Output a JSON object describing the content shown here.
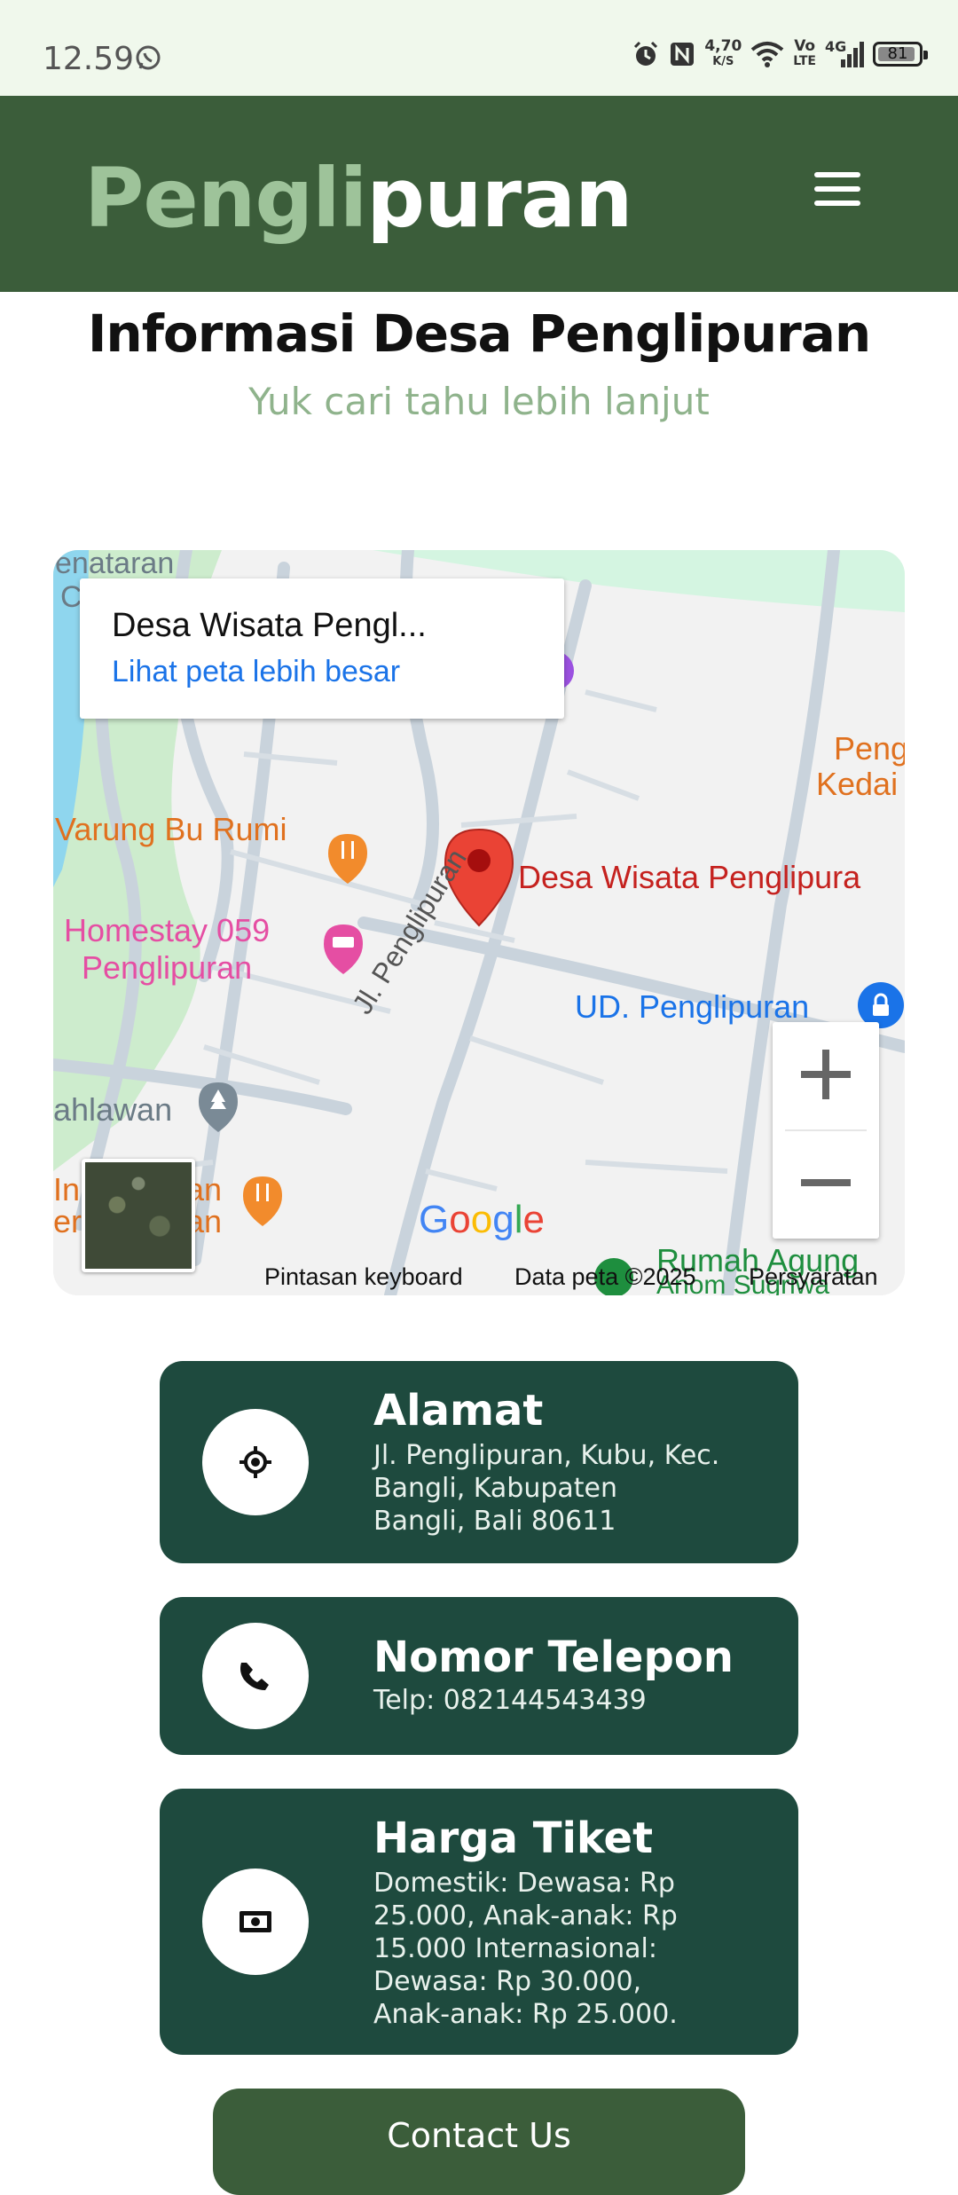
{
  "status_bar": {
    "time": "12.59",
    "speed_value": "4,70",
    "speed_unit": "K/S",
    "volte_top": "Vo",
    "volte_bottom": "LTE",
    "network": "4G",
    "battery": "81"
  },
  "header": {
    "logo_part1": "Pengli",
    "logo_part2": "puran",
    "accent_color": "#9ec39a",
    "background_color": "#3b5d3a"
  },
  "page": {
    "title": "Informasi Desa Penglipuran",
    "subtitle": "Yuk cari tahu lebih lanjut"
  },
  "map": {
    "card_title": "Desa Wisata Pengl...",
    "card_link": "Lihat peta lebih besar",
    "labels": {
      "penataran": "enataran",
      "c": "C",
      "pengli_kedai_1": "Pengli",
      "pengli_kedai_2": "Kedai J",
      "warung": "Varung Bu Rumi",
      "homestay_1": "Homestay 059",
      "homestay_2": "Penglipuran",
      "desa": "Desa Wisata Penglipura",
      "ud": "UD. Penglipuran",
      "road": "Jl. Penglipuran",
      "pahlawan": "ahlawan",
      "ian_1": "an",
      "ian_2": "an",
      "ian_3": "In",
      "ian_4": "er",
      "rumah": "Rumah Agung",
      "rumah_2": "Anom Sugriwa"
    },
    "google": "Google",
    "footer_keyboard": "Pintasan keyboard",
    "footer_data": "Data peta ©2025",
    "footer_terms": "Persyaratan"
  },
  "cards": [
    {
      "icon": "location-target-icon",
      "title": "Alamat",
      "lines": [
        "Jl. Penglipuran, Kubu, Kec.",
        "Bangli, Kabupaten",
        "Bangli, Bali 80611"
      ]
    },
    {
      "icon": "phone-icon",
      "title": "Nomor Telepon",
      "lines": [
        "Telp: 082144543439"
      ]
    },
    {
      "icon": "money-icon",
      "title": "Harga Tiket",
      "lines": [
        "Domestik: Dewasa: Rp",
        "25.000, Anak-anak: Rp",
        "15.000 Internasional:",
        "Dewasa: Rp 30.000,",
        "Anak-anak: Rp 25.000."
      ]
    }
  ],
  "contact_button": "Contact Us"
}
